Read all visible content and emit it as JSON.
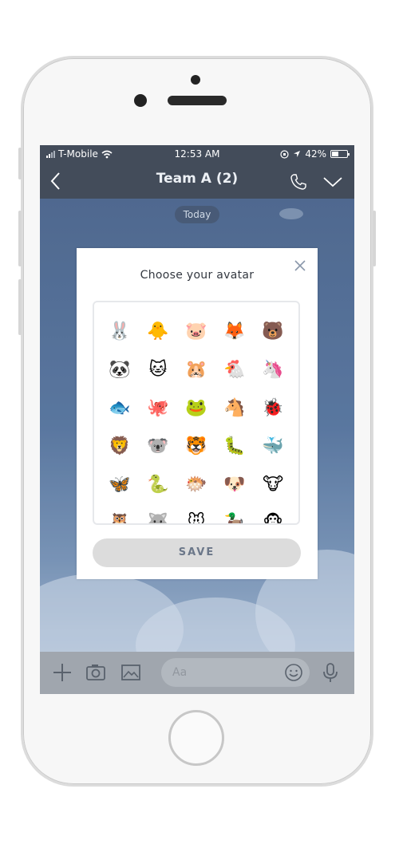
{
  "status_bar": {
    "carrier": "T-Mobile",
    "time": "12:53 AM",
    "battery": "42%",
    "battery_level": 0.42
  },
  "nav": {
    "title": "Team A (2)",
    "back_icon": "chevron-left-icon",
    "call_icon": "phone-icon",
    "menu_icon": "chevron-down-icon"
  },
  "chat": {
    "date_label": "Today"
  },
  "modal": {
    "title": "Choose your avatar",
    "close_icon": "close-icon",
    "save_label": "SAVE",
    "avatars": [
      "🐰",
      "🐥",
      "🐷",
      "🦊",
      "🐻",
      "🐼",
      "🐱",
      "🐹",
      "🐔",
      "🦄",
      "🐟",
      "🐙",
      "🐸",
      "🐴",
      "🐞",
      "🦁",
      "🐨",
      "🐯",
      "🐛",
      "🐳",
      "🦋",
      "🐍",
      "🐡",
      "🐶",
      "🐮",
      "🦉",
      "🐺",
      "🐭",
      "🦆",
      "🐵"
    ]
  },
  "input_bar": {
    "placeholder": "Aa",
    "add_icon": "plus-icon",
    "camera_icon": "camera-icon",
    "image_icon": "image-icon",
    "emoji_icon": "smiley-icon",
    "mic_icon": "microphone-icon"
  },
  "colors": {
    "nav_bg": "#1f2a3b",
    "chat_bg": "#3a5d8d",
    "save_bg": "#dcdcdc",
    "save_text": "#6b7789"
  }
}
